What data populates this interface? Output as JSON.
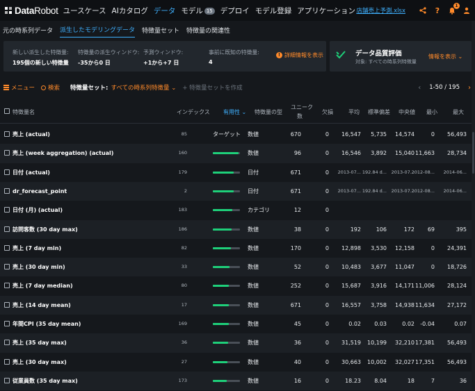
{
  "app": {
    "logo_bold": "Data",
    "logo_light": "Robot",
    "nav": [
      {
        "label": "ユースケース"
      },
      {
        "label": "AIカタログ"
      },
      {
        "label": "データ"
      },
      {
        "label": "モデル",
        "badge": "15"
      },
      {
        "label": "デプロイ"
      },
      {
        "label": "モデル登録"
      },
      {
        "label": "アプリケーション"
      }
    ],
    "file_name": "店舗売上予測.xlsx",
    "notifications_count": "1",
    "help_label": "?"
  },
  "subnav": [
    "元の時系列データ",
    "派生したモデリングデータ",
    "特徴量セット",
    "特徴量の関連性"
  ],
  "summary": {
    "items": [
      {
        "label": "新しい派生した特徴量:",
        "value": "195個の新しい特徴量"
      },
      {
        "label": "特徴量の派生ウィンドウ:",
        "value": "-35から0 日"
      },
      {
        "label": "予測ウィンドウ:",
        "value": "+1から+7 日"
      },
      {
        "label": "事前に既知の特徴量:",
        "value": "4"
      }
    ],
    "detail_link": "詳細情報を表示"
  },
  "quality": {
    "title": "データ品質評価",
    "subtitle": "対象: すべての時系列特徴量",
    "link": "情報を表示"
  },
  "toolbar": {
    "menu": "メニュー",
    "search": "検索",
    "featureset_label": "特徴量セット:",
    "featureset_value": "すべての時系列特徴量",
    "create": "特徴量セットを作成",
    "pager": "1-50 / 195"
  },
  "table": {
    "headers": {
      "name": "特徴量名",
      "index": "インデックス",
      "importance": "有用性",
      "var_type": "特徴量の型",
      "unique_1": "ユニーク",
      "unique_2": "数",
      "missing": "欠損",
      "mean": "平均",
      "std": "標準偏差",
      "median": "中央値",
      "min": "最小",
      "max": "最大"
    },
    "target_label": "ターゲット",
    "rows": [
      {
        "name": "売上 (actual)",
        "index": "85",
        "importance": null,
        "target": true,
        "type": "数値",
        "unique": "670",
        "missing": "0",
        "mean": "16,547",
        "std": "5,735",
        "median": "14,574",
        "min": "0",
        "max": "56,493"
      },
      {
        "name": "売上 (week aggregation) (actual)",
        "index": "160",
        "importance": 0.95,
        "type": "数値",
        "unique": "96",
        "missing": "0",
        "mean": "16,546",
        "std": "3,892",
        "median": "15,040",
        "min": "11,663",
        "max": "28,734"
      },
      {
        "name": "日付 (actual)",
        "index": "179",
        "importance": 0.78,
        "type": "日付",
        "unique": "671",
        "missing": "0",
        "mean": "2013-07...",
        "std": "192.84 d...",
        "median": "2013-07...",
        "min": "2012-08...",
        "max": "2014-06...",
        "small": true
      },
      {
        "name": "dr_forecast_point",
        "index": "2",
        "importance": 0.78,
        "type": "日付",
        "unique": "671",
        "missing": "0",
        "mean": "2013-07...",
        "std": "192.84 d...",
        "median": "2013-07...",
        "min": "2012-08...",
        "max": "2014-06...",
        "small": true
      },
      {
        "name": "日付 (月) (actual)",
        "index": "183",
        "importance": 0.72,
        "type": "カテゴリ",
        "unique": "12",
        "missing": "0",
        "mean": "",
        "std": "",
        "median": "",
        "min": "",
        "max": ""
      },
      {
        "name": "訪問客数 (30 day max)",
        "index": "186",
        "importance": 0.7,
        "type": "数値",
        "unique": "38",
        "missing": "0",
        "mean": "192",
        "std": "106",
        "median": "172",
        "min": "69",
        "max": "395"
      },
      {
        "name": "売上 (7 day min)",
        "index": "82",
        "importance": 0.66,
        "type": "数値",
        "unique": "170",
        "missing": "0",
        "mean": "12,898",
        "std": "3,530",
        "median": "12,158",
        "min": "0",
        "max": "24,391"
      },
      {
        "name": "売上 (30 day min)",
        "index": "33",
        "importance": 0.62,
        "type": "数値",
        "unique": "52",
        "missing": "0",
        "mean": "10,483",
        "std": "3,677",
        "median": "11,047",
        "min": "0",
        "max": "18,726"
      },
      {
        "name": "売上 (7 day median)",
        "index": "80",
        "importance": 0.6,
        "type": "数値",
        "unique": "252",
        "missing": "0",
        "mean": "15,687",
        "std": "3,916",
        "median": "14,171",
        "min": "11,006",
        "max": "28,124"
      },
      {
        "name": "売上 (14 day mean)",
        "index": "17",
        "importance": 0.6,
        "type": "数値",
        "unique": "671",
        "missing": "0",
        "mean": "16,557",
        "std": "3,758",
        "median": "14,938",
        "min": "11,634",
        "max": "27,172"
      },
      {
        "name": "年間CPI (35 day mean)",
        "index": "169",
        "importance": 0.58,
        "type": "数値",
        "unique": "45",
        "missing": "0",
        "mean": "0.02",
        "std": "0.03",
        "median": "0.02",
        "min": "-0.04",
        "max": "0.07"
      },
      {
        "name": "売上 (35 day max)",
        "index": "36",
        "importance": 0.56,
        "type": "数値",
        "unique": "36",
        "missing": "0",
        "mean": "31,519",
        "std": "10,199",
        "median": "32,210",
        "min": "17,381",
        "max": "56,493"
      },
      {
        "name": "売上 (30 day max)",
        "index": "27",
        "importance": 0.54,
        "type": "数値",
        "unique": "40",
        "missing": "0",
        "mean": "30,663",
        "std": "10,002",
        "median": "32,027",
        "min": "17,351",
        "max": "56,493"
      },
      {
        "name": "従業員数 (35 day max)",
        "index": "173",
        "importance": 0.52,
        "type": "数値",
        "unique": "16",
        "missing": "0",
        "mean": "18.23",
        "std": "8.04",
        "median": "18",
        "min": "7",
        "max": "36"
      }
    ]
  },
  "colors": {
    "accent": "#ff8a2a",
    "link": "#3fb1ff",
    "importance_bar": "#1ed07a",
    "background": "#15181c"
  }
}
